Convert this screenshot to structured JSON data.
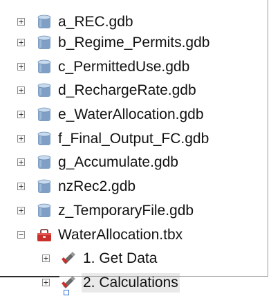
{
  "tree": {
    "items": [
      {
        "label": "a_REC.gdb",
        "icon": "geodatabase-icon",
        "expander": "plus"
      },
      {
        "label": "b_Regime_Permits.gdb",
        "icon": "geodatabase-icon",
        "expander": "plus"
      },
      {
        "label": "c_PermittedUse.gdb",
        "icon": "geodatabase-icon",
        "expander": "plus"
      },
      {
        "label": "d_RechargeRate.gdb",
        "icon": "geodatabase-icon",
        "expander": "plus"
      },
      {
        "label": "e_WaterAllocation.gdb",
        "icon": "geodatabase-icon",
        "expander": "plus"
      },
      {
        "label": "f_Final_Output_FC.gdb",
        "icon": "geodatabase-icon",
        "expander": "plus"
      },
      {
        "label": "g_Accumulate.gdb",
        "icon": "geodatabase-icon",
        "expander": "plus"
      },
      {
        "label": "nzRec2.gdb",
        "icon": "geodatabase-icon",
        "expander": "plus"
      },
      {
        "label": "z_TemporaryFile.gdb",
        "icon": "geodatabase-icon",
        "expander": "plus"
      },
      {
        "label": "WaterAllocation.tbx",
        "icon": "toolbox-icon",
        "expander": "minus"
      },
      {
        "label": "1. Get Data",
        "icon": "toolset-icon",
        "expander": "plus"
      },
      {
        "label": "2. Calculations",
        "icon": "toolset-icon",
        "expander": "plus",
        "selected": true
      }
    ]
  },
  "colors": {
    "geodatabase_body": "#7f9fc4",
    "geodatabase_top": "#c9dbef",
    "toolbox_red": "#c9302c",
    "toolset_gray": "#6b6b6b",
    "selection": "#e9e9e9"
  }
}
